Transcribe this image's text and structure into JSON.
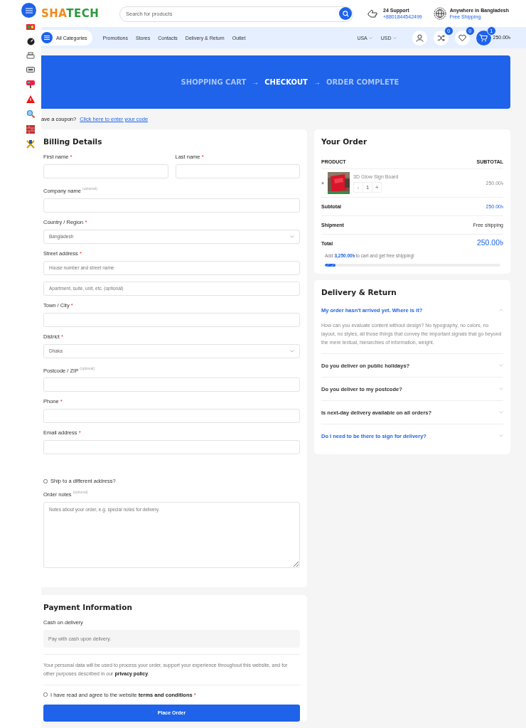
{
  "header": {
    "logo": {
      "part_1": "SHA",
      "part_2": "TECH"
    },
    "search": {
      "placeholder": "Search for products"
    },
    "support": {
      "title": "24 Support",
      "phone": "+8801844542499"
    },
    "location": {
      "title": "Anywhere in Bangladesh",
      "subtitle": "Free Shipping"
    }
  },
  "nav": {
    "categories_button": "All Categories",
    "links": [
      "Promotions",
      "Stores",
      "Contacts",
      "Delivery & Return",
      "Outlet"
    ],
    "selectors": [
      "USA",
      "USD"
    ],
    "compare_count": "0",
    "wishlist_count": "0",
    "cart_count": "1",
    "cart_total": "250.00৳"
  },
  "banner": {
    "steps": [
      {
        "label": "SHOPPING CART",
        "selected": false
      },
      {
        "label": "CHECKOUT",
        "selected": true
      },
      {
        "label": "ORDER COMPLETE",
        "selected": false
      }
    ],
    "separator": "→"
  },
  "coupon": {
    "text": "ave a coupon?",
    "link": "Click here to enter your code"
  },
  "billing": {
    "title": "Billing Details",
    "rows": [
      [
        {
          "kind": "text",
          "label": "First name",
          "mark": "*"
        },
        {
          "kind": "text",
          "label": "Last name",
          "mark": "*"
        }
      ],
      [
        {
          "kind": "text",
          "label": "Company name",
          "note": "(optional)"
        }
      ],
      [
        {
          "kind": "select",
          "label": "Country / Region",
          "mark": "*",
          "value": "Bangladesh"
        }
      ],
      [
        {
          "kind": "text",
          "label": "Street address",
          "mark": "*",
          "placeholder": "House number and street name"
        }
      ],
      [
        {
          "kind": "text",
          "placeholder": "Apartment, suite, unit, etc. (optional)"
        }
      ],
      [
        {
          "kind": "text",
          "label": "Town / City",
          "mark": "*"
        }
      ],
      [
        {
          "kind": "select",
          "label": "District",
          "mark": "*",
          "value": "Dhaka"
        }
      ],
      [
        {
          "kind": "text",
          "label": "Postcode / ZIP",
          "note": "(optional)"
        }
      ],
      [
        {
          "kind": "text",
          "label": "Phone",
          "mark": "*"
        }
      ],
      [
        {
          "kind": "text",
          "label": "Email address",
          "mark": "*"
        }
      ],
      [
        {
          "kind": "checkbox",
          "label": "Ship to a different address?",
          "checked": false
        }
      ],
      [
        {
          "kind": "textarea",
          "label": "Order notes",
          "note": "(optional)",
          "placeholder": "Notes about your order, e.g. special notes for delivery."
        }
      ]
    ]
  },
  "payment": {
    "title": "Payment Information",
    "method": "Cash on delivery",
    "description": "Pay with cash upon delivery.",
    "privacy_text": "Your personal data will be used to process your order, support your experience throughout this website, and for other purposes described in our **privacy policy**.",
    "terms": {
      "label": "I have read and agree to the website **terms and conditions**",
      "mark": "*",
      "checked": false
    },
    "button": "Place Order"
  },
  "order": {
    "title": "Your Order",
    "columns": [
      "PRODUCT",
      "SUBTOTAL"
    ],
    "items": [
      {
        "kind": "picture",
        "remove": "×",
        "name": "3D Glow Sign Board",
        "minus": "-",
        "quantity": "1",
        "plus": "+",
        "price": "250.00৳"
      }
    ],
    "totals": [
      {
        "label": "Subtotal",
        "value": "250.00৳",
        "kind": "accent"
      },
      {
        "label": "Shipment",
        "value": "Free shipping",
        "kind": "plain"
      },
      {
        "label": "Total",
        "value": "250.00৳",
        "kind": "large"
      }
    ],
    "shipping_note": "Add **3,250.00৳** to cart and get free shipping!",
    "shipping_progress": {
      "level": 0.06
    }
  },
  "delivery": {
    "title": "Delivery & Return",
    "faqs": [
      {
        "question": "My order hasn't arrived yet. Where is it?",
        "expanded": true,
        "active": true,
        "answer": "How can you evaluate content without design? No typography, no colors, no layout, no styles, all those things that convey the important signals that go beyond the mere textual, hierarchies of information, weight."
      },
      {
        "question": "Do you deliver on public holidays?",
        "expanded": false,
        "active": false
      },
      {
        "question": "Do you deliver to my postcode?",
        "expanded": false,
        "active": false
      },
      {
        "question": "Is next-day delivery available on all orders?",
        "expanded": false,
        "active": false
      },
      {
        "question": "Do I need to be there to sign for delivery?",
        "expanded": false,
        "active": true
      }
    ]
  }
}
